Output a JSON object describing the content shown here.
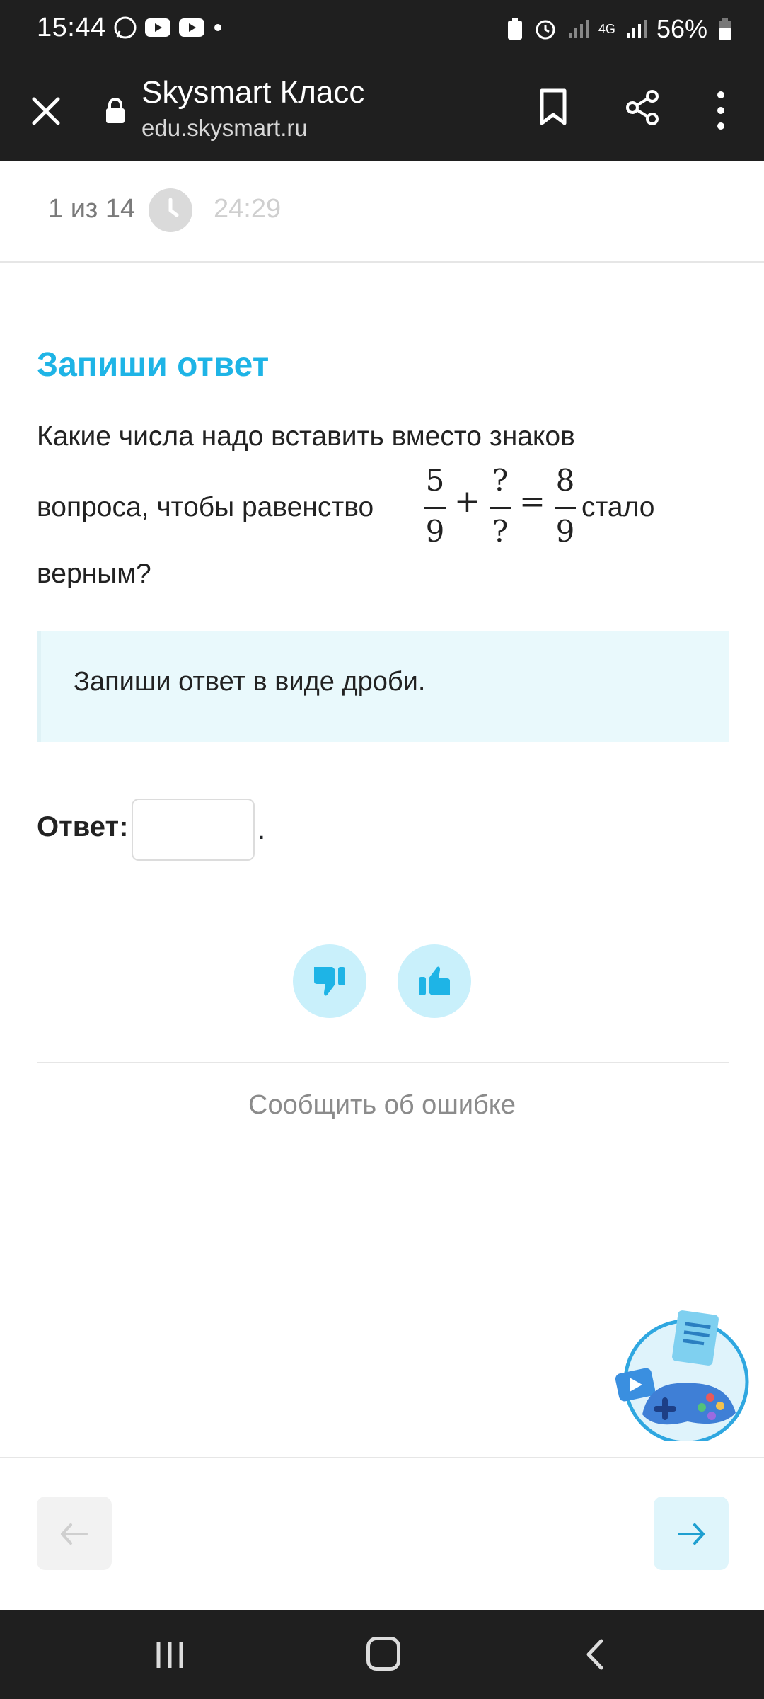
{
  "status_bar": {
    "time": "15:44",
    "battery": "56%",
    "network": "4G",
    "icons": [
      "whatsapp-icon",
      "youtube-icon",
      "youtube-icon",
      "dot-icon",
      "battery-saver-icon",
      "alarm-icon",
      "signal-icon",
      "signal-icon",
      "battery-icon"
    ]
  },
  "browser": {
    "title": "Skysmart Класс",
    "url": "edu.skysmart.ru",
    "icons": [
      "close-icon",
      "lock-icon",
      "bookmark-icon",
      "share-icon",
      "more-icon"
    ]
  },
  "progress": {
    "counter": "1 из 14",
    "timer": "24:29"
  },
  "task": {
    "heading": "Запиши ответ",
    "question_line1": "Какие числа надо вставить вместо знаков",
    "question_line2": "вопроса, чтобы равенство",
    "question_after": "стало",
    "question_line3": "верным?",
    "equation": {
      "frac1_num": "5",
      "frac1_den": "9",
      "plus": "+",
      "frac2_num": "?",
      "frac2_den": "?",
      "equals": "=",
      "frac3_num": "8",
      "frac3_den": "9"
    },
    "hint": "Запиши ответ в виде дроби.",
    "answer_label": "Ответ:",
    "answer_value": "",
    "answer_suffix": "."
  },
  "feedback": {
    "report": "Сообщить об ошибке"
  },
  "colors": {
    "accent": "#1eb4e6",
    "hint_bg": "#e9f9fc",
    "vote_bg": "#c9f0fb",
    "dark_bar": "#1f1f1f"
  }
}
